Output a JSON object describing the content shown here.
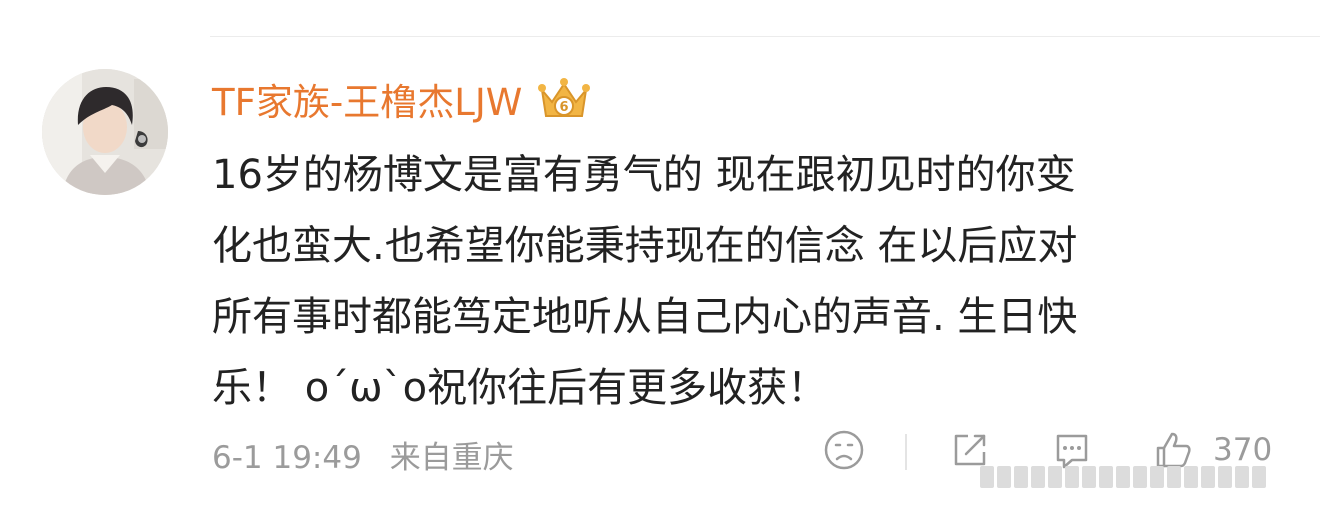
{
  "comment": {
    "username": "TF家族-王橹杰LJW",
    "badge_icon": "crown-badge-icon",
    "lines": [
      "16岁的杨博文是富有勇气的  现在跟初见时的你变",
      "化也蛮大.也希望你能秉持现在的信念  在以后应对",
      "所有事时都能笃定地听从自己内心的声音.  生日快",
      "乐！ o´ω`o祝你往后有更多收获！"
    ],
    "timestamp": "6-1 19:49",
    "location": "来自重庆",
    "like_count": "370"
  },
  "colors": {
    "username": "#e8782f",
    "text": "#222222",
    "meta": "#9b9b9b",
    "crown": "#f2b544"
  },
  "icons": [
    "sad-face-icon",
    "share-icon",
    "comment-icon",
    "like-icon",
    "crown-badge-icon"
  ]
}
